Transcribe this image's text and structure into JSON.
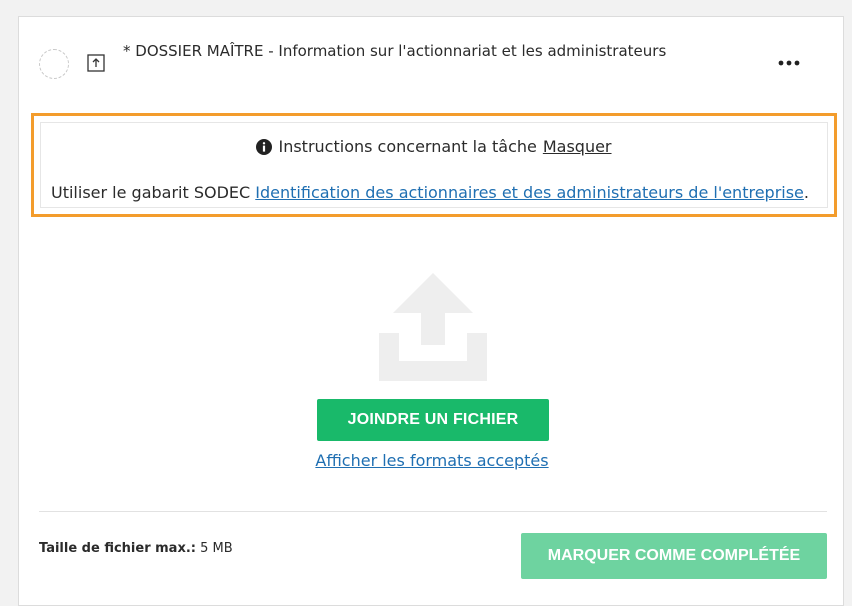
{
  "task": {
    "title": "* DOSSIER MAÎTRE - Information sur l'actionnariat et les administrateurs",
    "more_label": "•••"
  },
  "instructions": {
    "heading": "Instructions concernant la tâche",
    "hide_label": "Masquer",
    "body_prefix": "Utiliser le gabarit SODEC ",
    "template_link": "Identification des actionnaires et des administrateurs de l'entreprise",
    "body_suffix": "."
  },
  "upload": {
    "attach_label": "JOINDRE UN FICHIER",
    "formats_link": "Afficher les formats acceptés"
  },
  "footer": {
    "max_size_label": "Taille de fichier max.:",
    "max_size_value": " 5 MB",
    "complete_label": "MARQUER COMME COMPLÉTÉE"
  },
  "colors": {
    "highlight_border": "#f39c2c",
    "primary_green": "#19b96a",
    "disabled_green": "#6ed3a0",
    "link_blue": "#1f6fb2"
  },
  "icons": {
    "status": "dashed-circle-icon",
    "upload_type": "upload-box-icon",
    "more": "ellipsis-icon",
    "info": "info-circle-icon",
    "upload_zone": "upload-arrow-icon"
  }
}
